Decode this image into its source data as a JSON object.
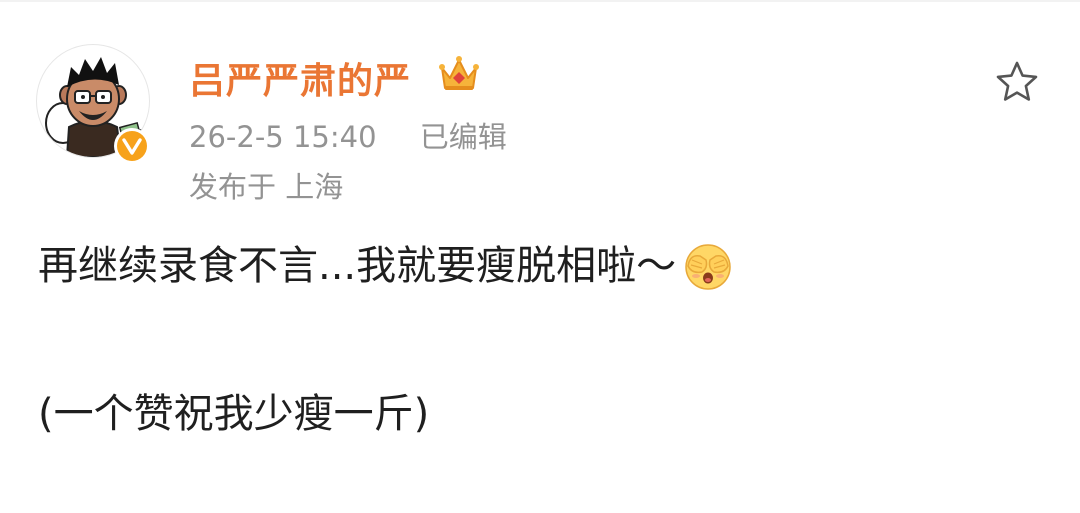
{
  "post": {
    "author": {
      "name": "吕严严肃的严",
      "avatar_icon": "cartoon-avatar-icon",
      "verified_icon": "verified-v-icon",
      "member_icon": "crown-icon"
    },
    "timestamp": "26-2-5 15:40",
    "edited_label": "已编辑",
    "location": "发布于 上海",
    "favorite_icon": "star-outline-icon",
    "content": {
      "line1": "再继续录食不言...我就要瘦脱相啦～",
      "line1_emoji": "face-covering-eyes-emoji",
      "line2": "(一个赞祝我少瘦一斤)"
    }
  },
  "colors": {
    "username": "#ea7634",
    "meta_text": "#939393",
    "body_text": "#1f1f1f",
    "verified_badge": "#f7a21b"
  }
}
